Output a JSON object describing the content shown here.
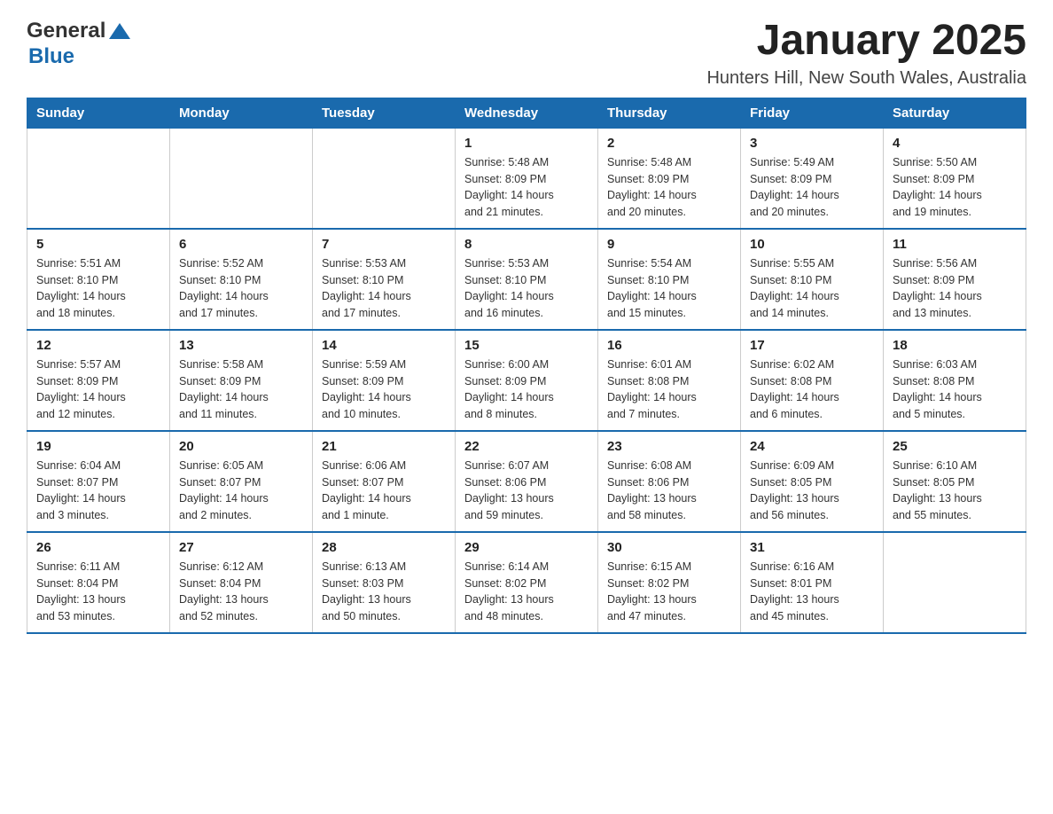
{
  "header": {
    "logo_general": "General",
    "logo_blue": "Blue",
    "month_title": "January 2025",
    "location": "Hunters Hill, New South Wales, Australia"
  },
  "days_of_week": [
    "Sunday",
    "Monday",
    "Tuesday",
    "Wednesday",
    "Thursday",
    "Friday",
    "Saturday"
  ],
  "weeks": [
    [
      {
        "day": "",
        "info": ""
      },
      {
        "day": "",
        "info": ""
      },
      {
        "day": "",
        "info": ""
      },
      {
        "day": "1",
        "info": "Sunrise: 5:48 AM\nSunset: 8:09 PM\nDaylight: 14 hours\nand 21 minutes."
      },
      {
        "day": "2",
        "info": "Sunrise: 5:48 AM\nSunset: 8:09 PM\nDaylight: 14 hours\nand 20 minutes."
      },
      {
        "day": "3",
        "info": "Sunrise: 5:49 AM\nSunset: 8:09 PM\nDaylight: 14 hours\nand 20 minutes."
      },
      {
        "day": "4",
        "info": "Sunrise: 5:50 AM\nSunset: 8:09 PM\nDaylight: 14 hours\nand 19 minutes."
      }
    ],
    [
      {
        "day": "5",
        "info": "Sunrise: 5:51 AM\nSunset: 8:10 PM\nDaylight: 14 hours\nand 18 minutes."
      },
      {
        "day": "6",
        "info": "Sunrise: 5:52 AM\nSunset: 8:10 PM\nDaylight: 14 hours\nand 17 minutes."
      },
      {
        "day": "7",
        "info": "Sunrise: 5:53 AM\nSunset: 8:10 PM\nDaylight: 14 hours\nand 17 minutes."
      },
      {
        "day": "8",
        "info": "Sunrise: 5:53 AM\nSunset: 8:10 PM\nDaylight: 14 hours\nand 16 minutes."
      },
      {
        "day": "9",
        "info": "Sunrise: 5:54 AM\nSunset: 8:10 PM\nDaylight: 14 hours\nand 15 minutes."
      },
      {
        "day": "10",
        "info": "Sunrise: 5:55 AM\nSunset: 8:10 PM\nDaylight: 14 hours\nand 14 minutes."
      },
      {
        "day": "11",
        "info": "Sunrise: 5:56 AM\nSunset: 8:09 PM\nDaylight: 14 hours\nand 13 minutes."
      }
    ],
    [
      {
        "day": "12",
        "info": "Sunrise: 5:57 AM\nSunset: 8:09 PM\nDaylight: 14 hours\nand 12 minutes."
      },
      {
        "day": "13",
        "info": "Sunrise: 5:58 AM\nSunset: 8:09 PM\nDaylight: 14 hours\nand 11 minutes."
      },
      {
        "day": "14",
        "info": "Sunrise: 5:59 AM\nSunset: 8:09 PM\nDaylight: 14 hours\nand 10 minutes."
      },
      {
        "day": "15",
        "info": "Sunrise: 6:00 AM\nSunset: 8:09 PM\nDaylight: 14 hours\nand 8 minutes."
      },
      {
        "day": "16",
        "info": "Sunrise: 6:01 AM\nSunset: 8:08 PM\nDaylight: 14 hours\nand 7 minutes."
      },
      {
        "day": "17",
        "info": "Sunrise: 6:02 AM\nSunset: 8:08 PM\nDaylight: 14 hours\nand 6 minutes."
      },
      {
        "day": "18",
        "info": "Sunrise: 6:03 AM\nSunset: 8:08 PM\nDaylight: 14 hours\nand 5 minutes."
      }
    ],
    [
      {
        "day": "19",
        "info": "Sunrise: 6:04 AM\nSunset: 8:07 PM\nDaylight: 14 hours\nand 3 minutes."
      },
      {
        "day": "20",
        "info": "Sunrise: 6:05 AM\nSunset: 8:07 PM\nDaylight: 14 hours\nand 2 minutes."
      },
      {
        "day": "21",
        "info": "Sunrise: 6:06 AM\nSunset: 8:07 PM\nDaylight: 14 hours\nand 1 minute."
      },
      {
        "day": "22",
        "info": "Sunrise: 6:07 AM\nSunset: 8:06 PM\nDaylight: 13 hours\nand 59 minutes."
      },
      {
        "day": "23",
        "info": "Sunrise: 6:08 AM\nSunset: 8:06 PM\nDaylight: 13 hours\nand 58 minutes."
      },
      {
        "day": "24",
        "info": "Sunrise: 6:09 AM\nSunset: 8:05 PM\nDaylight: 13 hours\nand 56 minutes."
      },
      {
        "day": "25",
        "info": "Sunrise: 6:10 AM\nSunset: 8:05 PM\nDaylight: 13 hours\nand 55 minutes."
      }
    ],
    [
      {
        "day": "26",
        "info": "Sunrise: 6:11 AM\nSunset: 8:04 PM\nDaylight: 13 hours\nand 53 minutes."
      },
      {
        "day": "27",
        "info": "Sunrise: 6:12 AM\nSunset: 8:04 PM\nDaylight: 13 hours\nand 52 minutes."
      },
      {
        "day": "28",
        "info": "Sunrise: 6:13 AM\nSunset: 8:03 PM\nDaylight: 13 hours\nand 50 minutes."
      },
      {
        "day": "29",
        "info": "Sunrise: 6:14 AM\nSunset: 8:02 PM\nDaylight: 13 hours\nand 48 minutes."
      },
      {
        "day": "30",
        "info": "Sunrise: 6:15 AM\nSunset: 8:02 PM\nDaylight: 13 hours\nand 47 minutes."
      },
      {
        "day": "31",
        "info": "Sunrise: 6:16 AM\nSunset: 8:01 PM\nDaylight: 13 hours\nand 45 minutes."
      },
      {
        "day": "",
        "info": ""
      }
    ]
  ]
}
